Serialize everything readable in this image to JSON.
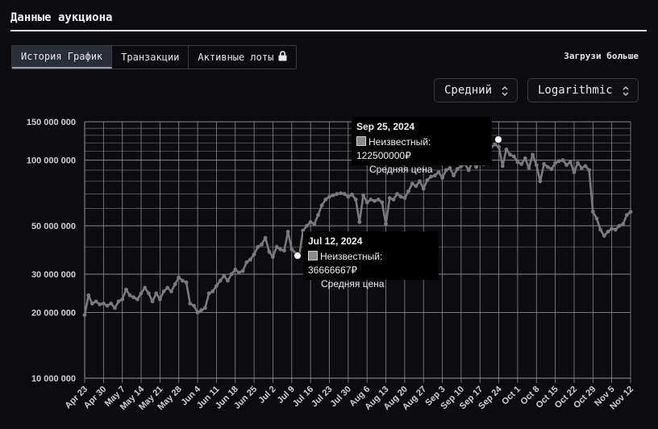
{
  "header": {
    "title": "Данные аукциона",
    "load_more": "Загрузи больше"
  },
  "tabs": [
    {
      "label": "История График",
      "active": true
    },
    {
      "label": "Транзакции",
      "active": false
    },
    {
      "label": "Активные лоты",
      "active": false,
      "icon": "lock-icon"
    }
  ],
  "controls": {
    "average": "Средний",
    "scale": "Logarithmic"
  },
  "colors": {
    "line": "#7a7a7a",
    "grid": "#6e6e72",
    "background": "#0c0c10",
    "tooltip_bg": "#000000"
  },
  "tooltips": [
    {
      "date": "Jul 12, 2024",
      "series": "Неизвестный: 36666667₽",
      "label": "Средняя цена"
    },
    {
      "date": "Sep 25, 2024",
      "series": "Неизвестный: 122500000₽",
      "label": "Средняя цена"
    }
  ],
  "chart_data": {
    "type": "line",
    "scale": "log",
    "grid": true,
    "ylim": [
      10000000,
      150000000
    ],
    "yticks": [
      {
        "value": 10000000,
        "label": "10 000 000"
      },
      {
        "value": 20000000,
        "label": "20 000 000"
      },
      {
        "value": 30000000,
        "label": "30 000 000"
      },
      {
        "value": 50000000,
        "label": "50 000 000"
      },
      {
        "value": 100000000,
        "label": "100 000 000"
      },
      {
        "value": 150000000,
        "label": "150 000 000"
      }
    ],
    "xticks": [
      "Apr 23",
      "Apr 30",
      "May 7",
      "May 14",
      "May 21",
      "May 28",
      "Jun 4",
      "Jun 11",
      "Jun 18",
      "Jun 25",
      "Jul 2",
      "Jul 9",
      "Jul 16",
      "Jul 23",
      "Jul 30",
      "Aug 6",
      "Aug 13",
      "Aug 20",
      "Aug 27",
      "Sep 3",
      "Sep 10",
      "Sep 17",
      "Sep 24",
      "Oct 1",
      "Oct 8",
      "Oct 15",
      "Oct 22",
      "Oct 29",
      "Nov 5",
      "Nov 12"
    ],
    "values": [
      19500000,
      24000000,
      22000000,
      22500000,
      21800000,
      22000000,
      21500000,
      22000000,
      21000000,
      22500000,
      23000000,
      25500000,
      24000000,
      23500000,
      23000000,
      24500000,
      26000000,
      24500000,
      22500000,
      24500000,
      23000000,
      25000000,
      26000000,
      25000000,
      27000000,
      29000000,
      28000000,
      27500000,
      22000000,
      21500000,
      20000000,
      20500000,
      21000000,
      24500000,
      25000000,
      26500000,
      28000000,
      29500000,
      28000000,
      30000000,
      31500000,
      30500000,
      31000000,
      34000000,
      35000000,
      37000000,
      40000000,
      41000000,
      44000000,
      38000000,
      36000000,
      40000000,
      39000000,
      38500000,
      47000000,
      39000000,
      37500000,
      36666667,
      47500000,
      50000000,
      52000000,
      51000000,
      56000000,
      62000000,
      66000000,
      68000000,
      69000000,
      70000000,
      70500000,
      70000000,
      68000000,
      69500000,
      66000000,
      52000000,
      69000000,
      64000000,
      66000000,
      65000000,
      66000000,
      64000000,
      51000000,
      67000000,
      66000000,
      70000000,
      68000000,
      67000000,
      72000000,
      78000000,
      76000000,
      80000000,
      74000000,
      81000000,
      84000000,
      85000000,
      88000000,
      83000000,
      90000000,
      92000000,
      85000000,
      91000000,
      94000000,
      96000000,
      90000000,
      98000000,
      93000000,
      100000000,
      96000000,
      122500000,
      115000000,
      118000000,
      115000000,
      94000000,
      112000000,
      106000000,
      104000000,
      98000000,
      96000000,
      102000000,
      92000000,
      106000000,
      95000000,
      80000000,
      96000000,
      93000000,
      91000000,
      97000000,
      99000000,
      100000000,
      95000000,
      98000000,
      88000000,
      97000000,
      92000000,
      94000000,
      90000000,
      58000000,
      54000000,
      48000000,
      45000000,
      47000000,
      48500000,
      48000000,
      50000000,
      51000000,
      56000000,
      58000000
    ]
  }
}
